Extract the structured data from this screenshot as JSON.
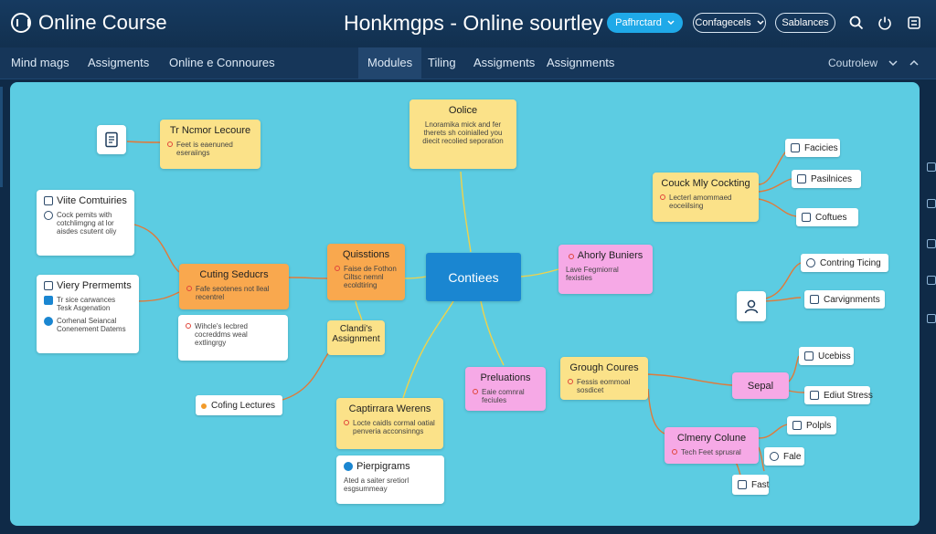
{
  "header": {
    "app_title": "Online Course",
    "center_title": "Honkmgps - Online sourtley",
    "primary_button": "Pafhrctard",
    "config_button": "Confagecels",
    "balances_button": "Sablances"
  },
  "nav": {
    "items": [
      "Mind mags",
      "Assigments",
      "Online e Connoures",
      "Modules",
      "Tiling",
      "Assigments",
      "Assignments"
    ],
    "right_label": "Coutrolew"
  },
  "nodes": {
    "lecture": {
      "title": "Tr Ncmor Lecoure",
      "text": "Feet is eaenuned eseraiings"
    },
    "police": {
      "title": "Oolice",
      "text": "Lnoramika mick and fer therets sh coinialled you diecit recolied seporation"
    },
    "video": {
      "title": "Viite Comtuiries",
      "text": "Cock pemits with cotchlimgng at lor aisdes csutent oliy"
    },
    "very": {
      "title": "Viery Prermemts",
      "row1": "Tr sice carwances Tesk Asgenation",
      "row2": "Corhenal Seiancal Conenement Datems"
    },
    "cutting": {
      "title": "Cuting Seducrs",
      "text": "Fafe seotenes not lleal recentrel"
    },
    "white_lecture": {
      "text": "Wihcle's lecbred cocreddms weal extlingrgy"
    },
    "questions": {
      "title": "Quisstions",
      "text": "Faise de Fothon Ciltsc nemnl ecoldtiring"
    },
    "content": {
      "title": "Contiees"
    },
    "clandis": {
      "title": "Clandi's Assignment"
    },
    "cofing": {
      "title": "Cofing Lectures"
    },
    "capt": {
      "title": "Captirrara Werens",
      "text": "Locte caidls cormal oatial penveria acconsinngs"
    },
    "perp": {
      "title": "Pierpigrams",
      "text": "Ated a saiter sretiorl esgsummeay"
    },
    "prel": {
      "title": "Preluations",
      "text": "Eaie comnral feciules"
    },
    "ahorly": {
      "title": "Ahorly Buniers",
      "text": "Lave Fegmiorral fexisties"
    },
    "couck": {
      "title": "Couck Mly Cockting",
      "text": "Lecterl amommaed eoceiilsing"
    },
    "grough": {
      "title": "Grough Coures",
      "text": "Fessis eommoal sosdicet"
    },
    "sepal": {
      "title": "Sepal"
    },
    "climeny": {
      "title": "Clmeny Colune",
      "text": "Tech Feet sprusral"
    }
  },
  "leaves": {
    "facicies": "Facicies",
    "pasilnices": "Pasilnices",
    "coftues": "Coftues",
    "contring": "Contring Ticing",
    "carvi": "Carvignments",
    "ucebiss": "Ucebiss",
    "ediut": "Ediut Stress",
    "polpls": "Polpls",
    "fale": "Fale",
    "fast": "Fast"
  },
  "icons": [
    "logo-icon",
    "search-icon",
    "power-icon",
    "settings-icon",
    "chevron-up-icon",
    "document-icon",
    "user-icon"
  ],
  "colors": {
    "accent": "#1fa9e8",
    "canvas": "#5ccce2",
    "topbar": "#163a60",
    "node_yellow": "#fbe289",
    "node_orange": "#f9a84e",
    "node_pink": "#f6a9e6",
    "node_blue": "#1a86d1"
  }
}
